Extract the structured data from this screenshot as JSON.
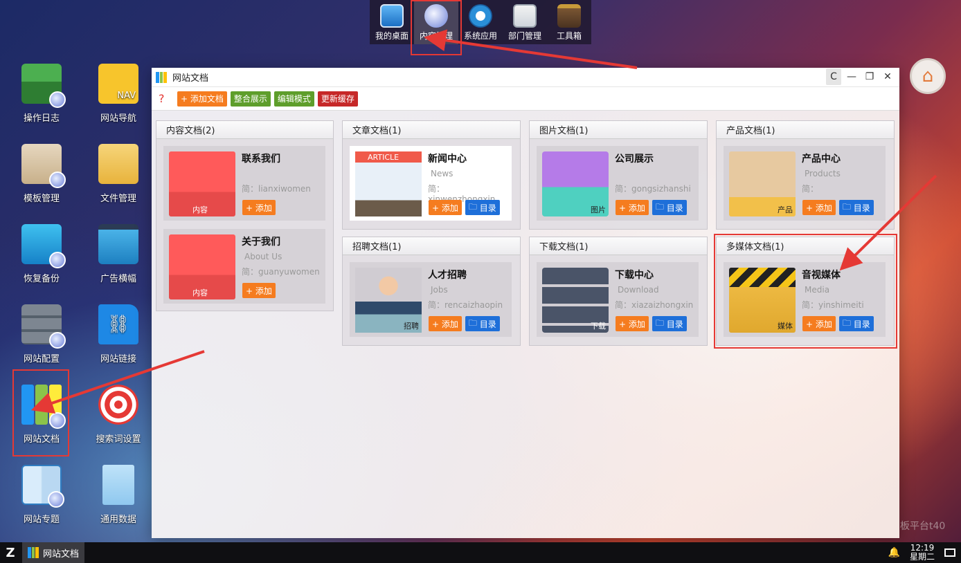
{
  "dock": {
    "items": [
      {
        "label": "我的桌面",
        "icon": "monitor-icon"
      },
      {
        "label": "内容管理",
        "icon": "globe-icon"
      },
      {
        "label": "系统应用",
        "icon": "gear-icon"
      },
      {
        "label": "部门管理",
        "icon": "badge-icon"
      },
      {
        "label": "工具箱",
        "icon": "toolbox-icon"
      }
    ]
  },
  "desktop": {
    "icons": [
      {
        "label": "操作日志",
        "icon": "folder-log-icon"
      },
      {
        "label": "网站导航",
        "icon": "nav-folder-icon",
        "text": "NAV"
      },
      {
        "label": "模板管理",
        "icon": "template-icon"
      },
      {
        "label": "文件管理",
        "icon": "file-folder-icon"
      },
      {
        "label": "恢复备份",
        "icon": "backup-server-icon"
      },
      {
        "label": "广告横幅",
        "icon": "banner-icon"
      },
      {
        "label": "网站配置",
        "icon": "server-config-icon"
      },
      {
        "label": "网站链接",
        "icon": "link-doc-icon"
      },
      {
        "label": "网站文档",
        "icon": "binders-icon"
      },
      {
        "label": "搜索词设置",
        "icon": "target-icon"
      },
      {
        "label": "网站专题",
        "icon": "topic-book-icon"
      },
      {
        "label": "通用数据",
        "icon": "data-doc-icon"
      }
    ]
  },
  "window": {
    "title": "网站文档",
    "controls": {
      "refresh": "C",
      "minimize": "—",
      "maximize": "❐",
      "close": "✕"
    },
    "toolbar": {
      "help_icon": "?",
      "buttons": [
        {
          "label": "+ 添加文档",
          "color": "#f57c1f"
        },
        {
          "label": "整合展示",
          "color": "#5e9e2b"
        },
        {
          "label": "编辑模式",
          "color": "#5e9e2b"
        },
        {
          "label": "更新缓存",
          "color": "#c62828"
        }
      ]
    },
    "panels": [
      {
        "title": "内容文档(2)",
        "cards": [
          {
            "title": "联系我们",
            "en": "",
            "slug": "简：lianxiwomen",
            "tag": "内容",
            "add": "+ 添加"
          },
          {
            "title": "关于我们",
            "en": "About Us",
            "slug": "简：guanyuwomen",
            "tag": "内容",
            "add": "+ 添加"
          }
        ]
      },
      {
        "title": "文章文档(1)",
        "cards": [
          {
            "title": "新闻中心",
            "en": "News",
            "slug": "简：xinwenzhongxin",
            "tag": "",
            "img_text": "ARTICLE",
            "add": "+ 添加",
            "dir": "目录"
          }
        ]
      },
      {
        "title": "图片文档(1)",
        "cards": [
          {
            "title": "公司展示",
            "en": "",
            "slug": "简：gongsizhanshi",
            "tag": "图片",
            "add": "+ 添加",
            "dir": "目录"
          }
        ]
      },
      {
        "title": "产品文档(1)",
        "cards": [
          {
            "title": "产品中心",
            "en": "Products",
            "slug": "简：",
            "tag": "产品",
            "add": "+ 添加",
            "dir": "目录"
          }
        ]
      },
      {
        "title": "招聘文档(1)",
        "cards": [
          {
            "title": "人才招聘",
            "en": "Jobs",
            "slug": "简：rencaizhaopin",
            "tag": "招聘",
            "add": "+ 添加",
            "dir": "目录"
          }
        ]
      },
      {
        "title": "下载文档(1)",
        "cards": [
          {
            "title": "下载中心",
            "en": "Download",
            "slug": "简：xiazaizhongxin",
            "tag": "下载",
            "add": "+ 添加",
            "dir": "目录"
          }
        ]
      },
      {
        "title": "多媒体文档(1)",
        "cards": [
          {
            "title": "音视媒体",
            "en": "Media",
            "slug": "简：yinshimeiti",
            "tag": "媒体",
            "add": "+ 添加",
            "dir": "目录"
          }
        ]
      }
    ]
  },
  "watermark": "板平台t40",
  "taskbar": {
    "start": "Z",
    "task_label": "网站文档",
    "time": "12:19",
    "weekday": "星期二"
  },
  "colors": {
    "add": "#f57c1f",
    "dir": "#1e6fd9",
    "annotation": "#e53935"
  }
}
